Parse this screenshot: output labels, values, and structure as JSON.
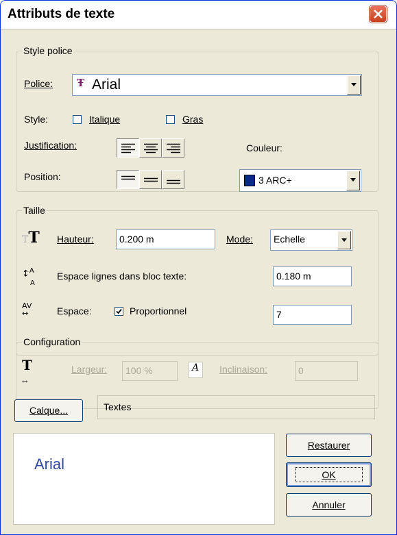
{
  "window": {
    "title": "Attributs de texte"
  },
  "style_police": {
    "legend": "Style police",
    "police_label": "Police:",
    "police_value": "Arial",
    "style_label": "Style:",
    "italique_label": "Italique",
    "italique_checked": false,
    "gras_label": "Gras",
    "gras_checked": false,
    "justification_label": "Justification:",
    "position_label": "Position:",
    "couleur_label": "Couleur:",
    "couleur_value": "3 ARC+",
    "couleur_swatch": "#0a2a8a"
  },
  "taille": {
    "legend": "Taille",
    "hauteur_label": "Hauteur:",
    "hauteur_value": "0.200 m",
    "mode_label": "Mode:",
    "mode_value": "Echelle",
    "espace_lignes_label": "Espace lignes dans bloc texte:",
    "espace_lignes_value": "0.180 m",
    "espace_label": "Espace:",
    "proportionnel_label": "Proportionnel",
    "proportionnel_checked": true,
    "espace_value": "7"
  },
  "configuration": {
    "legend": "Configuration",
    "largeur_label": "Largeur:",
    "largeur_value": "100 %",
    "inclinaison_label": "Inclinaison:",
    "inclinaison_value": "0"
  },
  "calque": {
    "button_label": "Calque...",
    "value": "Textes"
  },
  "preview": {
    "text": "Arial"
  },
  "buttons": {
    "restaurer": "Restaurer",
    "ok": "OK",
    "annuler": "Annuler"
  }
}
